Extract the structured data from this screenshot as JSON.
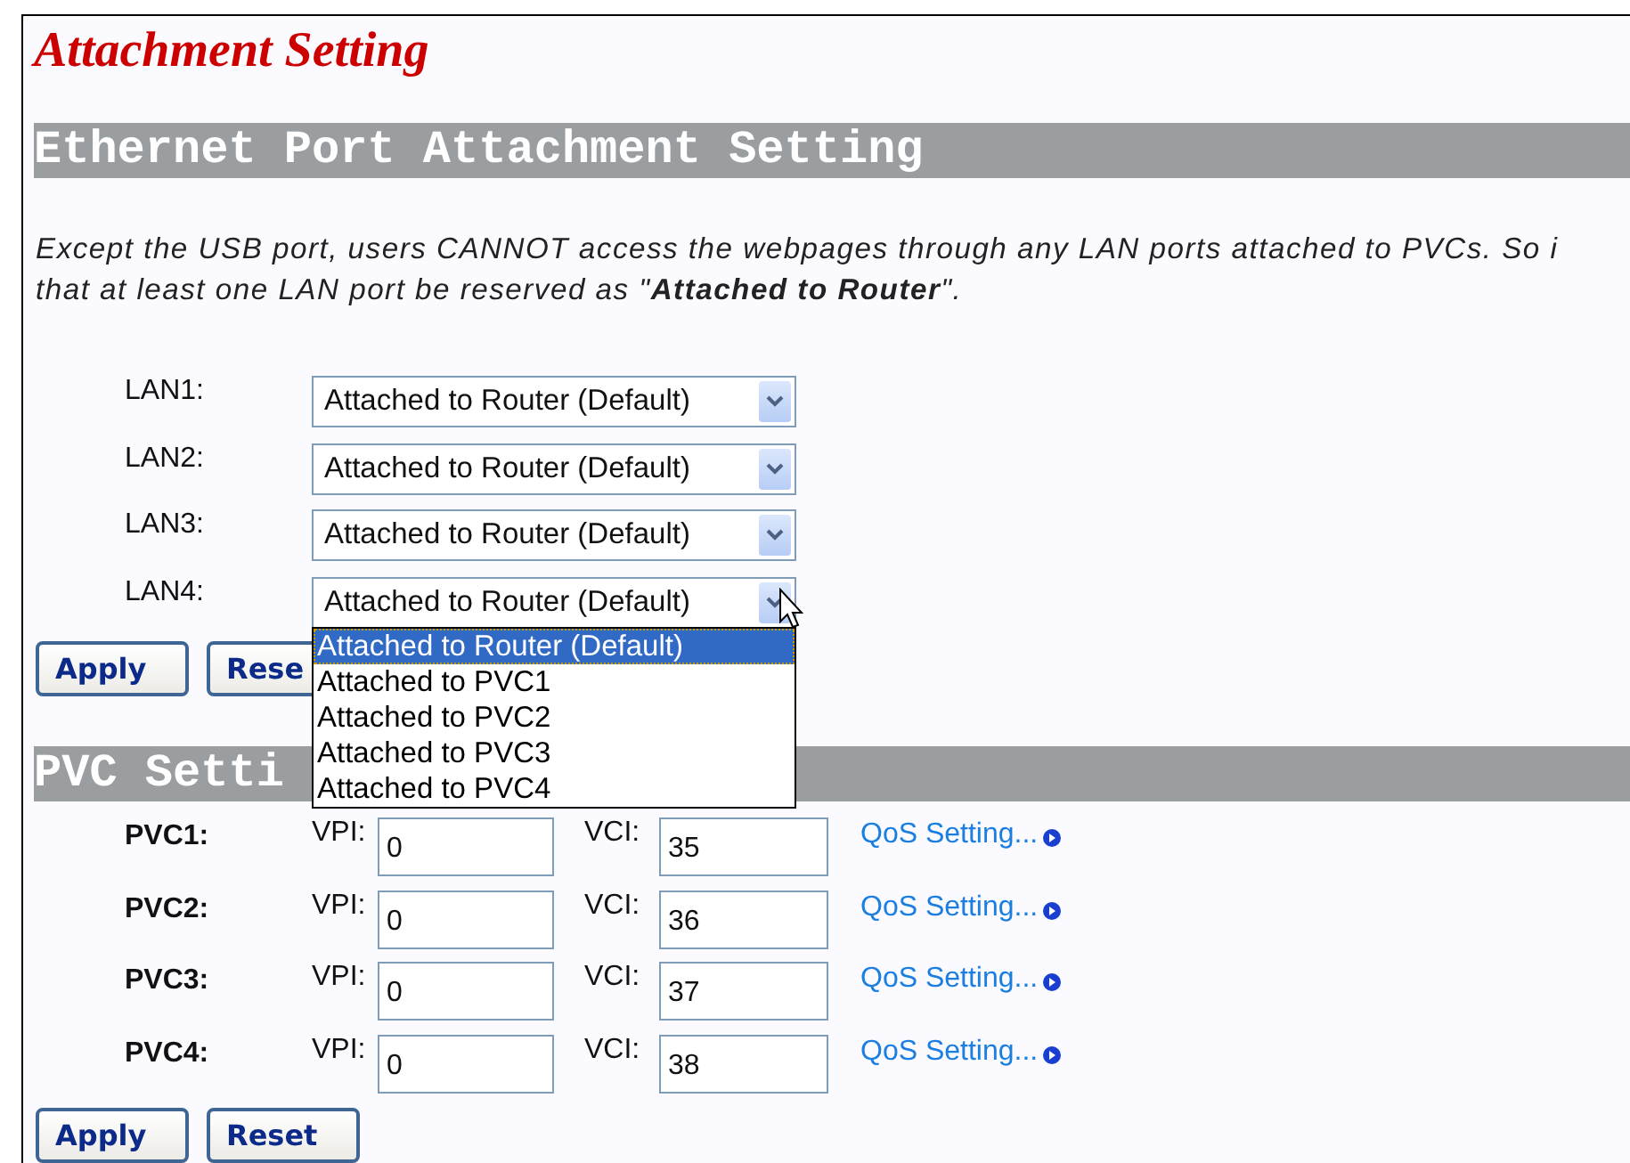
{
  "page_title": "Attachment Setting",
  "ethernet_section": {
    "heading": "Ethernet Port Attachment Setting",
    "note_lines": [
      "Except the USB port, users CANNOT access the webpages through any LAN ports attached to PVCs. So i",
      "that at least one LAN port be reserved as \"**Attached to Router**\"."
    ],
    "ports": [
      {
        "label": "LAN1:",
        "value": "Attached to Router (Default)",
        "open": false
      },
      {
        "label": "LAN2:",
        "value": "Attached to Router (Default)",
        "open": false
      },
      {
        "label": "LAN3:",
        "value": "Attached to Router (Default)",
        "open": false
      },
      {
        "label": "LAN4:",
        "value": "Attached to Router (Default)",
        "open": true,
        "options": [
          {
            "label": "Attached to Router (Default)",
            "selected": true
          },
          {
            "label": "Attached to PVC1",
            "selected": false
          },
          {
            "label": "Attached to PVC2",
            "selected": false
          },
          {
            "label": "Attached to PVC3",
            "selected": false
          },
          {
            "label": "Attached to PVC4",
            "selected": false
          }
        ]
      }
    ],
    "buttons": [
      "Apply",
      "Rese"
    ]
  },
  "pvc_section": {
    "heading": "PVC Setti",
    "rows": [
      {
        "label": "PVC1:",
        "vpi_label": "VPI:",
        "vpi": "0",
        "vci_label": "VCI:",
        "vci": "35",
        "link": "QoS Setting..."
      },
      {
        "label": "PVC2:",
        "vpi_label": "VPI:",
        "vpi": "0",
        "vci_label": "VCI:",
        "vci": "36",
        "link": "QoS Setting..."
      },
      {
        "label": "PVC3:",
        "vpi_label": "VPI:",
        "vpi": "0",
        "vci_label": "VCI:",
        "vci": "37",
        "link": "QoS Setting..."
      },
      {
        "label": "PVC4:",
        "vpi_label": "VPI:",
        "vpi": "0",
        "vci_label": "VCI:",
        "vci": "38",
        "link": "QoS Setting..."
      }
    ],
    "buttons": [
      "Apply",
      "Reset"
    ]
  }
}
